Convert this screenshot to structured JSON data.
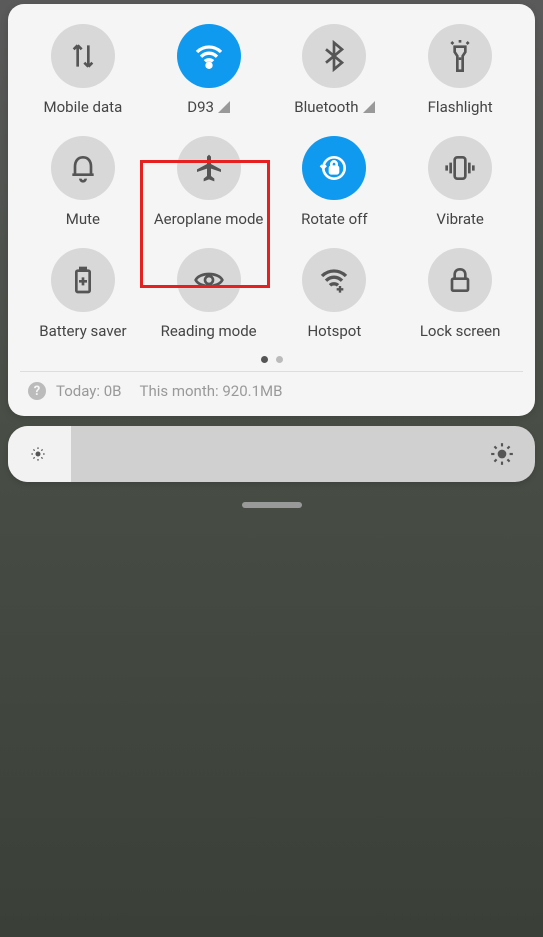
{
  "tiles": {
    "mobile_data": {
      "label": "Mobile data",
      "active": false
    },
    "wifi": {
      "label": "D93",
      "active": true,
      "signal": true
    },
    "bluetooth": {
      "label": "Bluetooth",
      "active": false,
      "signal": true
    },
    "flashlight": {
      "label": "Flashlight",
      "active": false
    },
    "mute": {
      "label": "Mute",
      "active": false
    },
    "aeroplane": {
      "label": "Aeroplane mode",
      "active": false
    },
    "rotate": {
      "label": "Rotate off",
      "active": true
    },
    "vibrate": {
      "label": "Vibrate",
      "active": false
    },
    "battery_saver": {
      "label": "Battery saver",
      "active": false
    },
    "reading_mode": {
      "label": "Reading mode",
      "active": false
    },
    "hotspot": {
      "label": "Hotspot",
      "active": false
    },
    "lock_screen": {
      "label": "Lock screen",
      "active": false
    }
  },
  "data_usage": {
    "today": "Today: 0B",
    "month": "This month: 920.1MB"
  },
  "brightness": {
    "value_pct": 12
  }
}
